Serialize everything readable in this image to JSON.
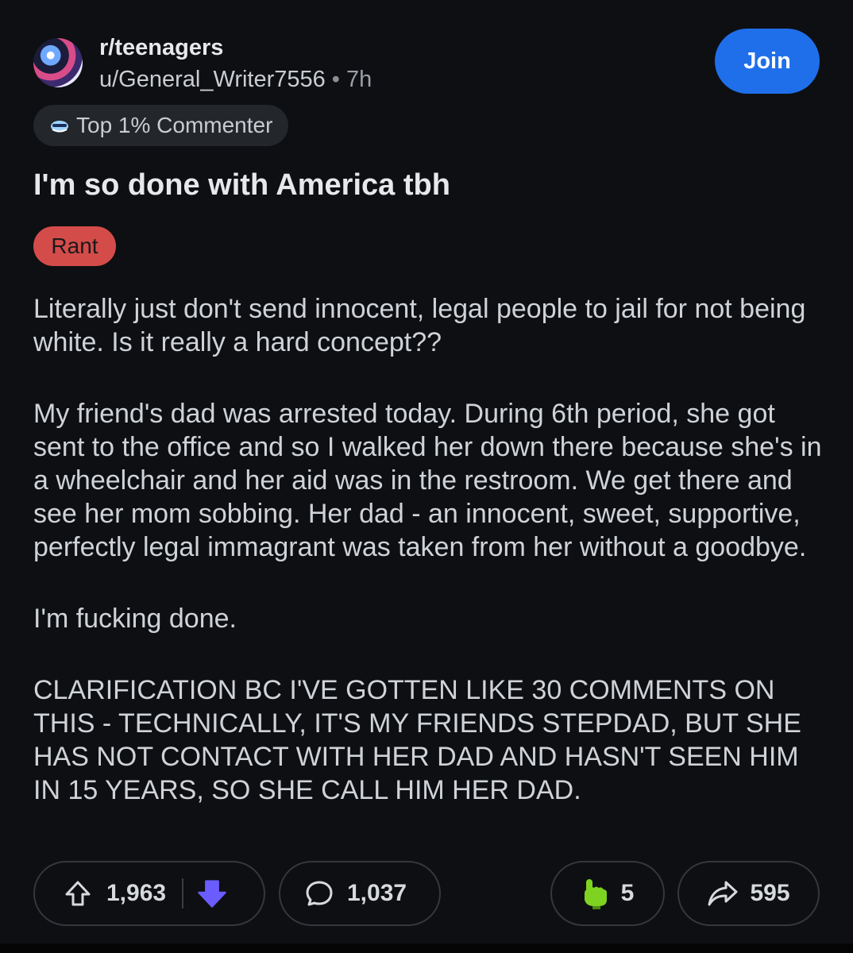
{
  "header": {
    "subreddit": "r/teenagers",
    "username": "u/General_Writer7556",
    "time": "7h",
    "join_label": "Join"
  },
  "badge": {
    "icon": "commenter-badge-icon",
    "label": "Top 1% Commenter"
  },
  "post": {
    "title": "I'm so done with America tbh",
    "flair": "Rant",
    "paragraphs": [
      "Literally just don't send innocent, legal people to jail for not being white. Is it really a hard concept??",
      "My friend's dad was arrested today. During 6th period, she got sent to the office and so I walked her down there because she's in a wheelchair and her aid was in the restroom. We get there and see her mom sobbing. Her dad - an innocent, sweet, supportive, perfectly legal immagrant was taken from her without a goodbye.",
      "I'm fucking done.",
      "CLARIFICATION BC I'VE GOTTEN LIKE 30 COMMENTS ON THIS - TECHNICALLY, IT'S MY FRIENDS STEPDAD, BUT SHE HAS NOT CONTACT WITH HER DAD AND HASN'T SEEN HIM IN 15 YEARS, SO SHE CALL HIM HER DAD."
    ]
  },
  "actions": {
    "upvotes": "1,963",
    "comments": "1,037",
    "awards": "5",
    "shares": "595",
    "colors": {
      "downvote": "#6a5cff",
      "award": "#7ed321",
      "join": "#1f6feb",
      "flair": "#d44c4a"
    }
  }
}
